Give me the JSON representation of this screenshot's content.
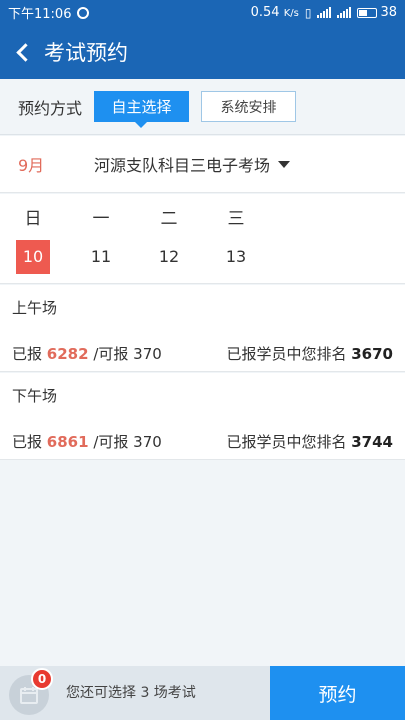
{
  "status_bar": {
    "time": "下午11:06",
    "net_speed": "0.54",
    "net_unit": "K/s",
    "battery": "38"
  },
  "header": {
    "title": "考试预约"
  },
  "mode": {
    "label": "预约方式",
    "option_self": "自主选择",
    "option_system": "系统安排"
  },
  "venue": {
    "month": "9月",
    "name": "河源支队科目三电子考场"
  },
  "week": [
    {
      "weekday": "日",
      "date": "10",
      "selected": true
    },
    {
      "weekday": "一",
      "date": "11",
      "selected": false
    },
    {
      "weekday": "二",
      "date": "12",
      "selected": false
    },
    {
      "weekday": "三",
      "date": "13",
      "selected": false
    }
  ],
  "sessions": [
    {
      "title": "上午场",
      "reported_label": "已报",
      "reported": "6282",
      "capacity_label": "/可报",
      "capacity": "370",
      "rank_label": "已报学员中您排名",
      "rank": "3670"
    },
    {
      "title": "下午场",
      "reported_label": "已报",
      "reported": "6861",
      "capacity_label": "/可报",
      "capacity": "370",
      "rank_label": "已报学员中您排名",
      "rank": "3744"
    }
  ],
  "bottom": {
    "badge": "0",
    "hint": "您还可选择 3 场考试",
    "book_label": "预约"
  },
  "colors": {
    "primary": "#1b66b5",
    "accent": "#1e90f0",
    "highlight": "#e16b5b"
  }
}
